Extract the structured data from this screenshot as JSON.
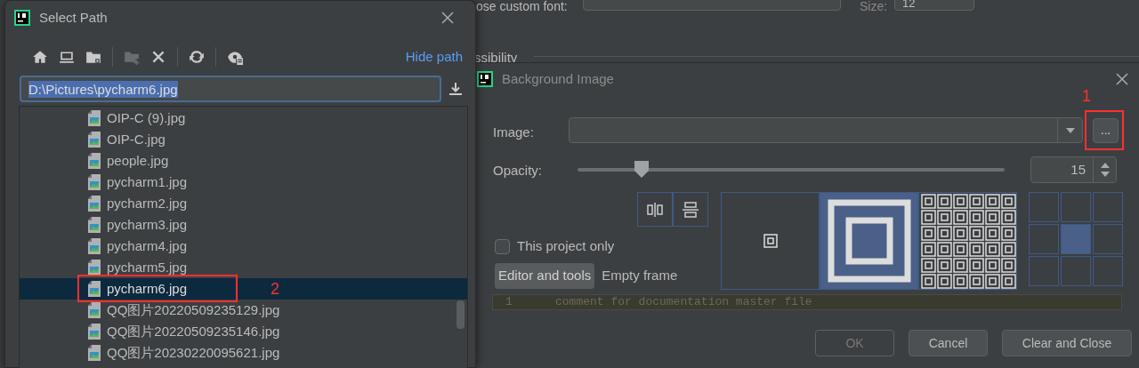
{
  "background_settings": {
    "font_label": "ose custom font:",
    "size_label": "Size:",
    "size_value": "12",
    "section": "ssibility"
  },
  "select_path": {
    "title": "Select Path",
    "toolbar": [
      {
        "kind": "home",
        "disabled": false
      },
      {
        "kind": "desktop",
        "disabled": false
      },
      {
        "kind": "folder",
        "disabled": false
      },
      {
        "kind": "new-folder",
        "disabled": true
      },
      {
        "kind": "delete",
        "disabled": false
      },
      {
        "kind": "refresh",
        "disabled": false
      },
      {
        "kind": "hidden",
        "disabled": false
      }
    ],
    "hide_path": "Hide path",
    "path": "D:\\Pictures\\pycharm6.jpg",
    "files": [
      {
        "name": "OIP-C (9).jpg",
        "selected": false
      },
      {
        "name": "OIP-C.jpg",
        "selected": false
      },
      {
        "name": "people.jpg",
        "selected": false
      },
      {
        "name": "pycharm1.jpg",
        "selected": false
      },
      {
        "name": "pycharm2.jpg",
        "selected": false
      },
      {
        "name": "pycharm3.jpg",
        "selected": false
      },
      {
        "name": "pycharm4.jpg",
        "selected": false
      },
      {
        "name": "pycharm5.jpg",
        "selected": false
      },
      {
        "name": "pycharm6.jpg",
        "selected": true
      },
      {
        "name": "QQ图片20220509235129.jpg",
        "selected": false
      },
      {
        "name": "QQ图片20220509235146.jpg",
        "selected": false
      },
      {
        "name": "QQ图片20230220095621.jpg",
        "selected": false
      }
    ],
    "annotation": "2"
  },
  "background_image": {
    "title": "Background Image",
    "image_label": "Image:",
    "browse": "...",
    "annotation": "1",
    "opacity_label": "Opacity:",
    "opacity": {
      "level": 0.15
    },
    "opacity_value": "15",
    "this_project_only": {
      "label": "This project only",
      "checked": false
    },
    "targets": [
      {
        "label": "Editor and tools",
        "selected": true
      },
      {
        "label": "Empty frame",
        "selected": false
      }
    ],
    "fill_modes": [
      {
        "kind": "plain",
        "selected": false
      },
      {
        "kind": "scale",
        "selected": true
      },
      {
        "kind": "tile",
        "selected": false
      }
    ],
    "anchor": [
      {
        "selected": false
      },
      {
        "selected": false
      },
      {
        "selected": false
      },
      {
        "selected": false
      },
      {
        "selected": true
      },
      {
        "selected": false
      },
      {
        "selected": false
      },
      {
        "selected": false
      },
      {
        "selected": false
      }
    ],
    "preview": {
      "line_number": "1",
      "text": "comment for documentation master file"
    },
    "buttons": [
      {
        "label": "OK",
        "disabled": true
      },
      {
        "label": "Cancel",
        "disabled": false
      },
      {
        "label": "Clear and Close",
        "disabled": false
      }
    ]
  }
}
